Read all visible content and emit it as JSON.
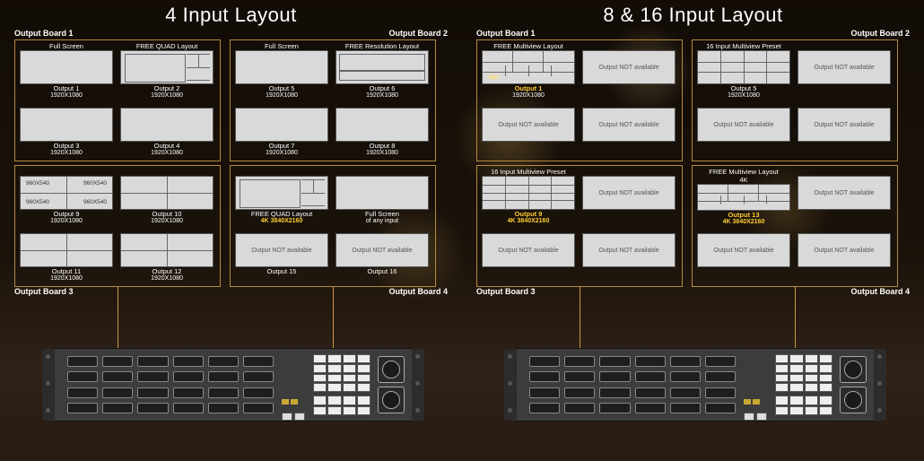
{
  "left": {
    "title": "4 Input Layout",
    "board_labels": {
      "b1": "Output Board 1",
      "b2": "Output Board 2",
      "b3": "Output Board 3",
      "b4": "Output Board 4"
    },
    "boards": {
      "A": {
        "c1": {
          "header": "Full Screen",
          "out": "Output 1",
          "res": "1920X1080"
        },
        "c2": {
          "header": "FREE QUAD Layout",
          "out": "Output 2",
          "res": "1920X1080"
        },
        "c3": {
          "header": "",
          "out": "Output 3",
          "res": "1920X1080"
        },
        "c4": {
          "header": "",
          "out": "Output 4",
          "res": "1920X1080"
        }
      },
      "B": {
        "c1": {
          "header": "Full Screen",
          "out": "Output 5",
          "res": "1920X1080"
        },
        "c2": {
          "header": "FREE Resolution Layout",
          "out": "Output 6",
          "res": "1920X1080"
        },
        "c3": {
          "header": "",
          "out": "Output 7",
          "res": "1920X1080"
        },
        "c4": {
          "header": "",
          "out": "Output 8",
          "res": "1920X1080"
        }
      },
      "C": {
        "c1": {
          "header": "",
          "out": "Output 9",
          "res": "1920X1080",
          "q": [
            "960X540",
            "960X540",
            "960X540",
            "960X540"
          ]
        },
        "c2": {
          "header": "",
          "out": "Output 10",
          "res": "1920X1080"
        },
        "c3": {
          "header": "",
          "out": "Output 11",
          "res": "1920X1080"
        },
        "c4": {
          "header": "",
          "out": "Output 12",
          "res": "1920X1080"
        }
      },
      "D": {
        "c1": {
          "header": "",
          "out": "FREE QUAD Layout",
          "res": "4K 3840X2160"
        },
        "c2": {
          "header": "",
          "out": "Full Screen",
          "res": "of any input"
        },
        "c3": {
          "header": "",
          "na": "Output NOT available",
          "out": "Output 15",
          "res": ""
        },
        "c4": {
          "header": "",
          "na": "Output NOT available",
          "out": "Output 16",
          "res": ""
        }
      }
    }
  },
  "right": {
    "title": "8 & 16 Input Layout",
    "board_labels": {
      "b1": "Output Board 1",
      "b2": "Output Board 2",
      "b3": "Output Board 3",
      "b4": "Output Board 4"
    },
    "boards": {
      "A": {
        "c1": {
          "header": "FREE Multiview Layout",
          "out": "Output 1",
          "res": "1920X1080"
        },
        "c2": {
          "header": "",
          "na": "Output NOT available",
          "out": "",
          "res": ""
        },
        "c3": {
          "header": "",
          "na": "Output NOT available",
          "out": "",
          "res": ""
        },
        "c4": {
          "header": "",
          "na": "Output NOT available",
          "out": "",
          "res": ""
        }
      },
      "B": {
        "c1": {
          "header": "16 Input Multiview Preset",
          "out": "Output 5",
          "res": "1920X1080"
        },
        "c2": {
          "header": "",
          "na": "Output NOT available",
          "out": "",
          "res": ""
        },
        "c3": {
          "header": "",
          "na": "Output NOT available",
          "out": "",
          "res": ""
        },
        "c4": {
          "header": "",
          "na": "Output NOT available",
          "out": "",
          "res": ""
        }
      },
      "C": {
        "c1": {
          "header": "16 Input Multiview Preset",
          "out": "Output 9",
          "res": "4K 3840X2160"
        },
        "c2": {
          "header": "",
          "na": "Output NOT available",
          "out": "",
          "res": ""
        },
        "c3": {
          "header": "",
          "na": "Output NOT available",
          "out": "",
          "res": ""
        },
        "c4": {
          "header": "",
          "na": "Output NOT available",
          "out": "",
          "res": ""
        }
      },
      "D": {
        "c1": {
          "header": "FREE Multiview Layout",
          "header2": "4K",
          "out": "Output 13",
          "res": "4K 3840X2160"
        },
        "c2": {
          "header": "",
          "na": "Output NOT available",
          "out": "",
          "res": ""
        },
        "c3": {
          "header": "",
          "na": "Output NOT available",
          "out": "",
          "res": ""
        },
        "c4": {
          "header": "",
          "na": "Output NOT available",
          "out": "",
          "res": ""
        }
      }
    }
  }
}
